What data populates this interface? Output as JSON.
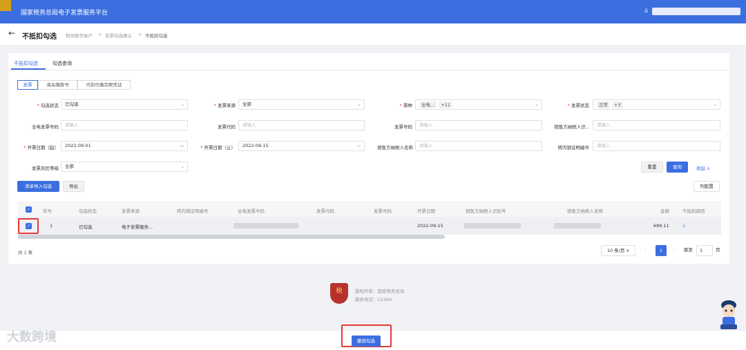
{
  "header": {
    "title": "国家税务总局电子发票服务平台"
  },
  "page": {
    "title": "不抵扣勾选",
    "back": "←"
  },
  "breadcrumb": {
    "items": [
      "税务数字账户",
      "发票勾选确认",
      "不抵扣勾选"
    ],
    "sep": ">"
  },
  "tabs": [
    "不抵扣勾选",
    "勾选查询"
  ],
  "doc_types": [
    "发票",
    "海关缴款书",
    "代扣代缴完税凭证"
  ],
  "filters": {
    "check_status": {
      "label": "勾选状态",
      "value": "已勾选"
    },
    "source": {
      "label": "发票来源",
      "value": "全部"
    },
    "type": {
      "label": "票种",
      "tag": "全电...",
      "more": "+11"
    },
    "inv_status": {
      "label": "发票状态",
      "tag": "正常",
      "more": "+3"
    },
    "quandian_no": {
      "label": "全电发票号码",
      "placeholder": "请输入"
    },
    "inv_code": {
      "label": "发票代码",
      "placeholder": "请输入"
    },
    "inv_no": {
      "label": "发票号码",
      "placeholder": "请输入"
    },
    "seller_id": {
      "label": "销售方纳税人识...",
      "placeholder": "请输入"
    },
    "date_start": {
      "label": "开票日期（起）",
      "value": "2022-09-01"
    },
    "date_end": {
      "label": "开票日期（止）",
      "value": "2022-09-15"
    },
    "seller_name": {
      "label": "销售方纳税人名称",
      "placeholder": "请输入"
    },
    "transfer_no": {
      "label": "转内销证明编号",
      "placeholder": "请输入"
    },
    "risk": {
      "label": "发票风险等级",
      "value": "全部"
    }
  },
  "actions": {
    "reset": "重置",
    "query": "查询",
    "collapse": "收起 ∧",
    "import": "清单导入勾选",
    "export": "导出",
    "columns": "列配置"
  },
  "table": {
    "columns": [
      "序号",
      "勾选状态",
      "发票来源",
      "转内销证明编号",
      "全电发票号码",
      "发票代码",
      "发票号码",
      "开票日期",
      "销售方纳税人识别号",
      "销售方纳税人名称",
      "金额",
      "不抵扣原因"
    ],
    "row": {
      "no": "1",
      "status": "已勾选",
      "source": "电子发票服务...",
      "date": "2022-09-15",
      "amount": "699.11",
      "reason": "1"
    }
  },
  "pagination": {
    "total": "共 1 条",
    "size": "10 条/页 ∨",
    "prev": "‹",
    "page": "1",
    "next": "›",
    "jump": "跳至",
    "jump_val": "1",
    "unit": "页"
  },
  "footer": {
    "copyright": "版权所有：国家税务总局",
    "phone": "服务电话：12366",
    "logo": "税"
  },
  "bottom": {
    "undo": "撤销勾选"
  },
  "watermark": "大数跨境"
}
